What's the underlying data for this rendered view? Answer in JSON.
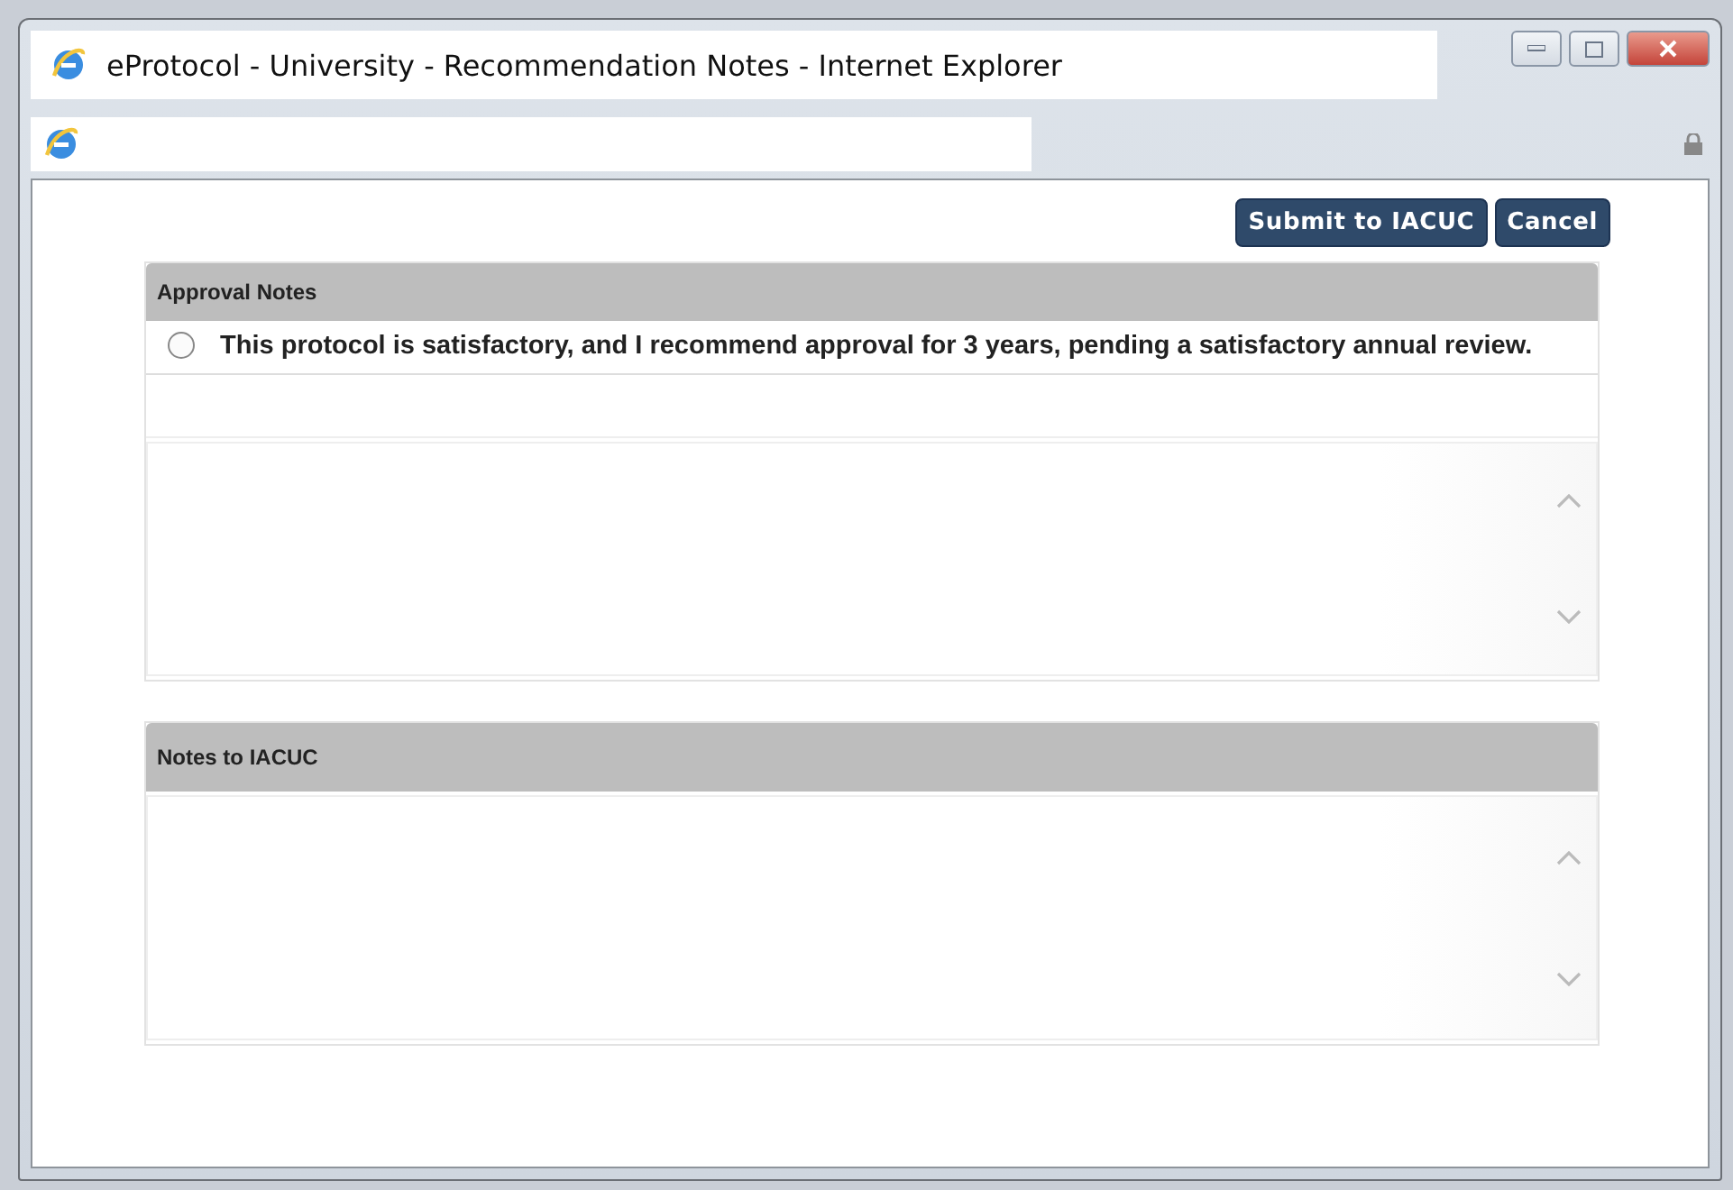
{
  "window": {
    "title": "eProtocol - University - Recommendation Notes - Internet Explorer"
  },
  "buttons": [
    "Submit to IACUC",
    "Cancel"
  ],
  "sections": [
    {
      "kind": "options",
      "heading": "Approval Notes",
      "options": [
        {
          "label": "This protocol is satisfactory, and I recommend approval for 3 years, pending a satisfactory annual review.",
          "selected": false
        }
      ]
    },
    {
      "kind": "notes",
      "heading": "Notes to IACUC"
    }
  ]
}
